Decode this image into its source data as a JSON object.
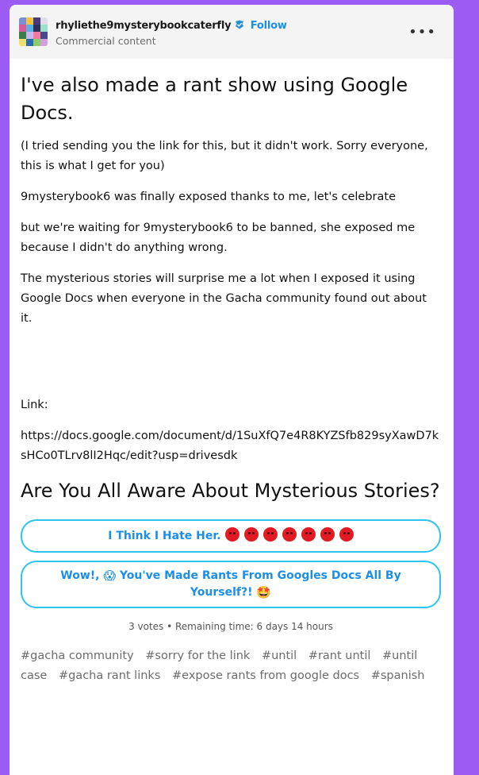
{
  "post": {
    "username": "rhyliethe9mysterybookcaterfly",
    "follow_label": "Follow",
    "subtitle": "Commercial content",
    "title": "I've also made a rant show using Google Docs.",
    "paragraphs": [
      "(I tried sending you the link for this, but it didn't work. Sorry everyone, this is what I get for you)",
      "9mysterybook6 was finally exposed thanks to me, let's celebrate",
      "but we're waiting for 9mysterybook6 to be banned, she exposed me because I didn't do anything wrong.",
      "The mysterious stories will surprise me a lot when I exposed it using Google Docs when everyone in the Gacha community found out about it."
    ],
    "link_label": "Link:",
    "link_url": "https://docs.google.com/document/d/1SuXfQ7e4R8KYZSfb829syXawD7ksHCo0TLrv8lI2Hqc/edit?usp=drivesdk"
  },
  "poll": {
    "question": "Are You All Aware About Mysterious Stories?",
    "options": [
      {
        "label": "I Think I Hate Her.",
        "emoji": "angry-face x7"
      },
      {
        "label_before": "Wow!,",
        "emoji_before": "screaming-face",
        "label": "You've Made Rants From Googles Docs All By Yourself?!",
        "emoji_after": "star-struck-face"
      }
    ],
    "meta": "3 votes • Remaining time: 6 days 14 hours"
  },
  "tags": [
    "#gacha community",
    "#sorry for the link",
    "#until",
    "#rant until",
    "#until case",
    "#gacha rant links",
    "#expose rants from google docs",
    "#spanish"
  ],
  "colors": {
    "background": "#9c5cf3",
    "card": "#ffffff",
    "header": "#f4f4f4",
    "accent": "#1d8ee6",
    "poll_border": "#2ec4f0"
  },
  "icons": {
    "more": "ellipsis-icon",
    "verified": "verified-badge-icon"
  }
}
